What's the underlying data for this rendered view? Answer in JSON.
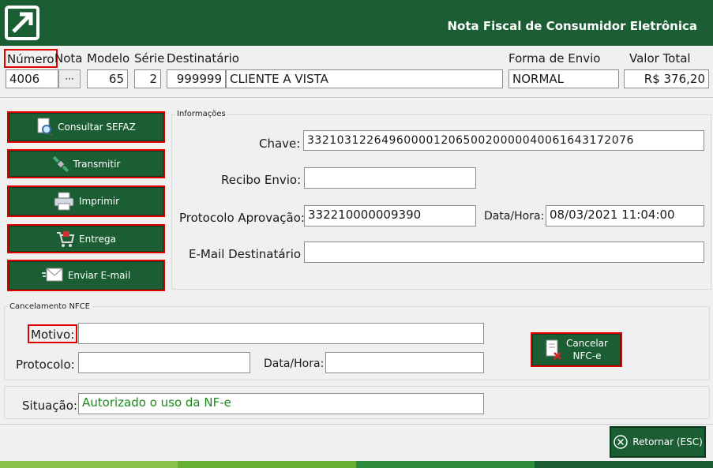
{
  "header": {
    "title": "Nota Fiscal de Consumidor Eletrônica",
    "logo": "arrow-logo-icon",
    "color": "#1c5e33"
  },
  "labels": {
    "numero": "Número",
    "nota": "Nota",
    "modelo": "Modelo",
    "serie": "Série",
    "destinatario": "Destinatário",
    "forma_envio": "Forma de Envio",
    "valor_total": "Valor Total"
  },
  "fields": {
    "numero": "4006",
    "lookup_button": "···",
    "modelo": "65",
    "serie": "2",
    "destinatario_codigo": "999999",
    "destinatario_nome": "CLIENTE A VISTA",
    "forma_envio": "NORMAL",
    "valor_total": "R$ 376,20"
  },
  "actions": {
    "consultar": "Consultar SEFAZ",
    "transmitir": "Transmitir",
    "imprimir": "Imprimir",
    "entrega": "Entrega",
    "email": "Enviar E-mail"
  },
  "informacoes": {
    "title": "Informações",
    "chave_label": "Chave:",
    "chave_value": "33210312264960000120650020000040061643172076",
    "recibo_label": "Recibo Envio:",
    "recibo_value": "",
    "protocolo_label": "Protocolo Aprovação:",
    "protocolo_value": "332210000009390",
    "datahora_label": "Data/Hora:",
    "datahora_value": "08/03/2021 11:04:00",
    "email_label": "E-Mail Destinatário :",
    "email_value": ""
  },
  "cancelamento": {
    "title": "Cancelamento NFCE",
    "motivo_label": "Motivo:",
    "motivo_value": "",
    "protocolo_label": "Protocolo:",
    "protocolo_value": "",
    "datahora_label": "Data/Hora:",
    "datahora_value": "",
    "button_line1": "Cancelar",
    "button_line2": "NFC-e"
  },
  "situacao": {
    "label": "Situação:",
    "value": "Autorizado o uso da NF-e",
    "color": "#1a8a1a"
  },
  "footer": {
    "retornar": "Retornar (ESC)"
  },
  "colors": {
    "accent": "#1c5e33",
    "highlight": "#e00000"
  }
}
